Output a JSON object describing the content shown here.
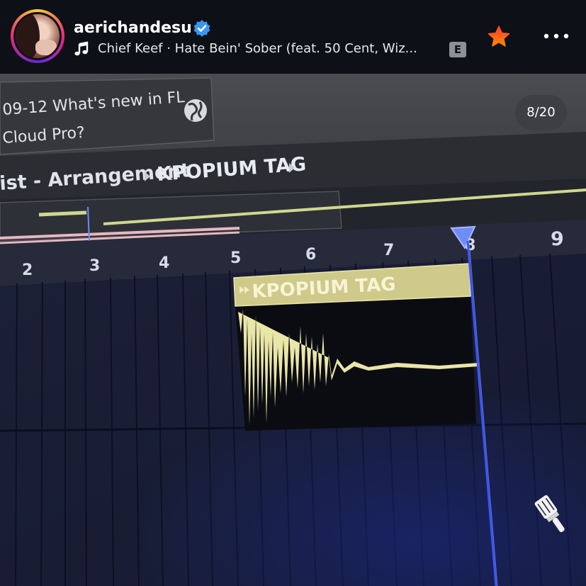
{
  "header": {
    "username": "aerichandesu",
    "track": "Chief Keef · Hate Bein' Sober (feat. 50 Cent, Wiz...",
    "explicit_badge": "E"
  },
  "photo": {
    "news_line1": "09-12 What's new in FL",
    "news_line2": "Cloud Pro?",
    "breadcrumb_1": "ist - Arrangement",
    "breadcrumb_2": "KPOPIUM TAG",
    "ruler": [
      "2",
      "3",
      "4",
      "5",
      "6",
      "7",
      "8",
      "9"
    ],
    "clip_label": "KPOPIUM TAG"
  },
  "counter": "8/20",
  "colors": {
    "verified": "#3897f0",
    "star": "#ff6a1a",
    "clip": "#cfc98a",
    "waveform": "#e9e6a8",
    "playhead": "#3a54ff"
  },
  "icons": [
    "verified-icon",
    "music-note-icon",
    "star-icon",
    "more-icon",
    "globe-icon",
    "paintbrush-icon"
  ]
}
